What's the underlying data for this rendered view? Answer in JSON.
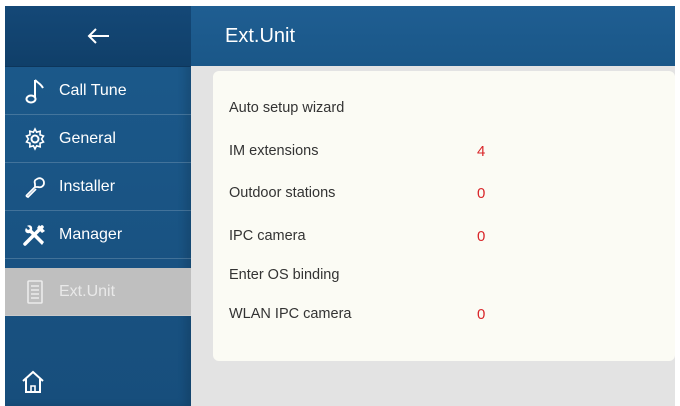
{
  "header": {
    "title": "Ext.Unit"
  },
  "sidebar": {
    "items": [
      {
        "label": "Call Tune",
        "icon": "music-note-icon"
      },
      {
        "label": "General",
        "icon": "gear-icon"
      },
      {
        "label": "Installer",
        "icon": "wrench-icon"
      },
      {
        "label": "Manager",
        "icon": "tools-icon"
      },
      {
        "label": "Ext.Unit",
        "icon": "document-icon",
        "active": true
      }
    ]
  },
  "panel": {
    "rows": [
      {
        "label": "Auto setup wizard",
        "value": ""
      },
      {
        "label": "IM extensions",
        "value": "4"
      },
      {
        "label": "Outdoor stations",
        "value": "0"
      },
      {
        "label": "IPC camera",
        "value": "0"
      },
      {
        "label": "Enter OS binding",
        "value": ""
      },
      {
        "label": "WLAN IPC camera",
        "value": "0"
      }
    ]
  },
  "colors": {
    "sidebar": "#1c5a8c",
    "header": "#1f5e92",
    "active_item": "#bfbfbf",
    "value": "#d9262a"
  }
}
